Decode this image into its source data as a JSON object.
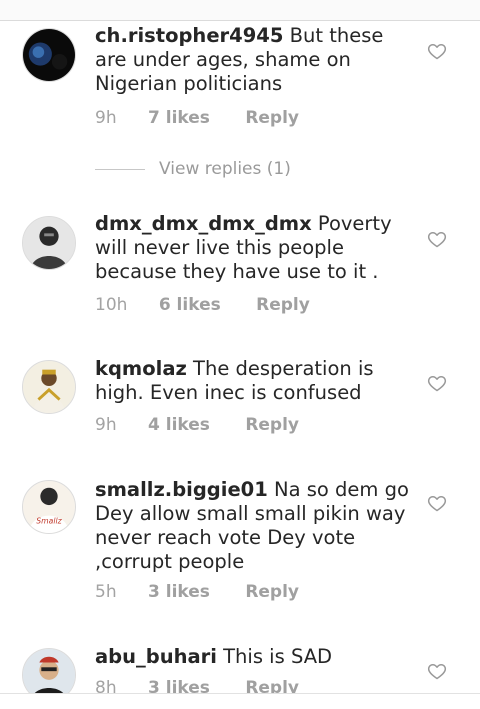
{
  "comments": [
    {
      "username": "ch.ristopher4945",
      "text": "But these are under ages, shame on Nigerian politicians",
      "time": "9h",
      "likes": "7 likes",
      "reply": "Reply",
      "view_replies": "View replies (1)"
    },
    {
      "username": "dmx_dmx_dmx_dmx",
      "text": "Poverty will never live this people because they have use to it .",
      "time": "10h",
      "likes": "6 likes",
      "reply": "Reply"
    },
    {
      "username": "kqmolaz",
      "text": "The desperation is high. Even inec is confused",
      "time": "9h",
      "likes": "4 likes",
      "reply": "Reply"
    },
    {
      "username": "smallz.biggie01",
      "text": "Na so dem go Dey allow small small pikin way never reach vote Dey vote ,corrupt people",
      "time": "5h",
      "likes": "3 likes",
      "reply": "Reply"
    },
    {
      "username": "abu_buhari",
      "text": "This is SAD",
      "time": "8h",
      "likes": "3 likes",
      "reply": "Reply"
    }
  ],
  "icons": {
    "like": "heart-outline-icon"
  },
  "colors": {
    "text": "#262626",
    "meta": "#a3a3a3",
    "divider": "#dbdbdb"
  }
}
